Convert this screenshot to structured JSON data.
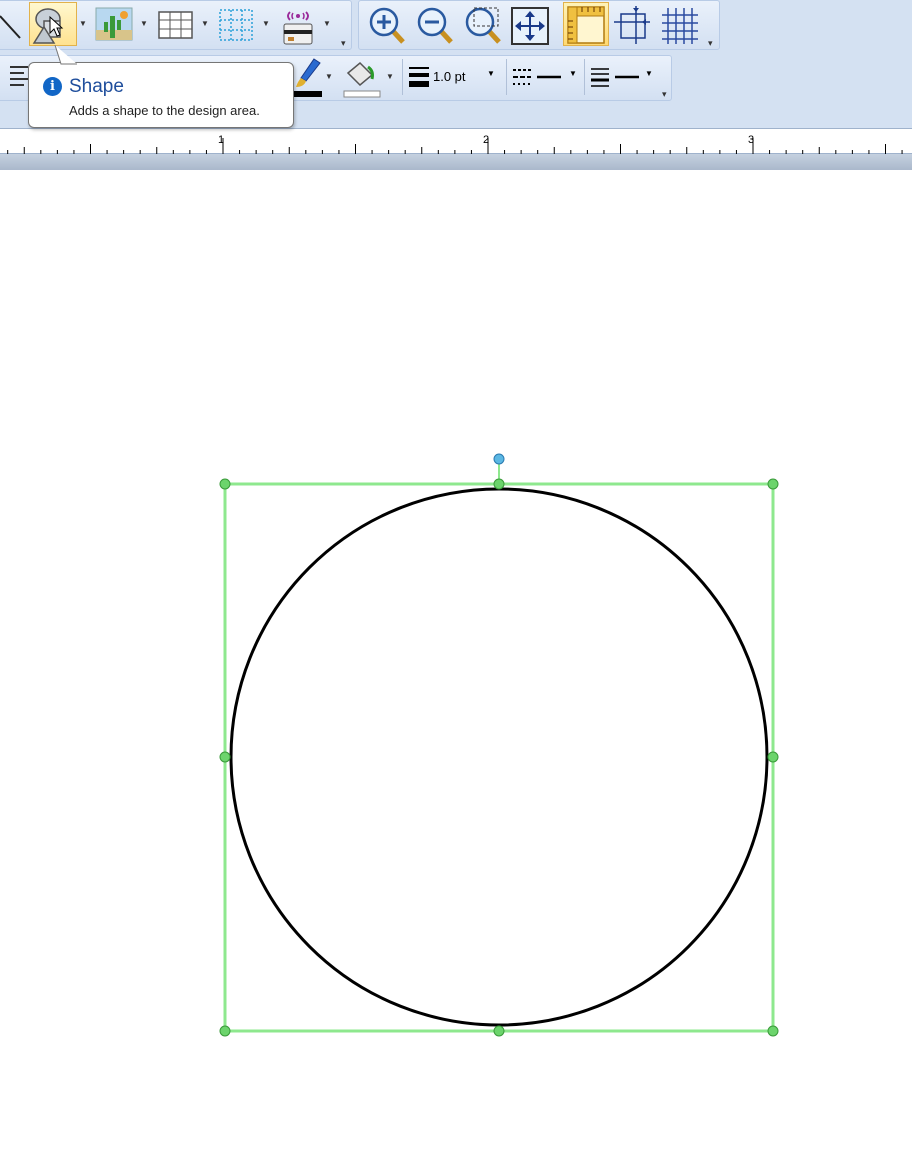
{
  "toolbar": {
    "row1": [
      {
        "name": "line-tool-button",
        "icon": "diagonal-line-icon"
      },
      {
        "name": "shape-tool-button",
        "icon": "shape-icon",
        "state": "hover"
      },
      {
        "name": "picture-tool-button",
        "icon": "picture-icon"
      },
      {
        "name": "table-tool-button",
        "icon": "table-icon"
      },
      {
        "name": "grid-tool-button",
        "icon": "dotted-grid-icon"
      },
      {
        "name": "rfid-tool-button",
        "icon": "rfid-icon"
      },
      {
        "name": "zoom-in-button",
        "icon": "zoom-in-icon"
      },
      {
        "name": "zoom-out-button",
        "icon": "zoom-out-icon"
      },
      {
        "name": "zoom-selection-button",
        "icon": "zoom-selection-icon"
      },
      {
        "name": "fit-page-button",
        "icon": "fit-page-icon"
      },
      {
        "name": "ruler-toggle-button",
        "icon": "ruler-icon",
        "state": "active"
      },
      {
        "name": "margins-button",
        "icon": "margins-icon"
      },
      {
        "name": "gridlines-button",
        "icon": "gridlines-icon"
      }
    ],
    "line_width": "1.0 pt"
  },
  "tooltip": {
    "title": "Shape",
    "description": "Adds a shape to the design area.",
    "icon": "info-icon"
  },
  "ruler": {
    "labels": [
      "1",
      "2",
      "3"
    ]
  },
  "colors": {
    "toolbar_bg": "#d4e1f2",
    "selection": "#8ee88e",
    "handle": "#6cd46c",
    "rotate_handle": "#5bb7e3",
    "shape_stroke": "#000000"
  },
  "design": {
    "shape": "circle",
    "selected": true
  }
}
